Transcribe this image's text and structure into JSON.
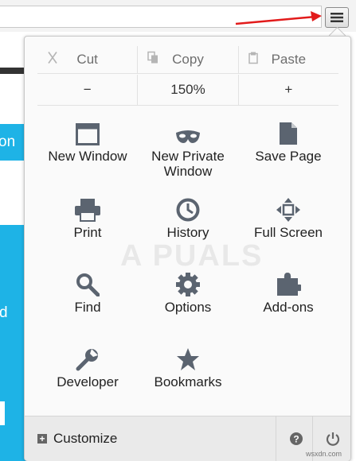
{
  "menu": {
    "edit": {
      "cut": "Cut",
      "copy": "Copy",
      "paste": "Paste"
    },
    "zoom": {
      "out": "−",
      "level": "150%",
      "in": "+"
    },
    "items": [
      {
        "label": "New Window",
        "icon": "new-window-icon"
      },
      {
        "label": "New Private Window",
        "icon": "private-mask-icon"
      },
      {
        "label": "Save Page",
        "icon": "save-page-icon"
      },
      {
        "label": "Print",
        "icon": "printer-icon"
      },
      {
        "label": "History",
        "icon": "clock-icon"
      },
      {
        "label": "Full Screen",
        "icon": "fullscreen-icon"
      },
      {
        "label": "Find",
        "icon": "magnifier-icon"
      },
      {
        "label": "Options",
        "icon": "gear-icon"
      },
      {
        "label": "Add-ons",
        "icon": "puzzle-icon"
      },
      {
        "label": "Developer",
        "icon": "wrench-icon"
      },
      {
        "label": "Bookmarks",
        "icon": "star-icon"
      }
    ],
    "footer": {
      "customize": "Customize"
    }
  },
  "background": {
    "text1": "on",
    "text2": "d"
  },
  "watermark": "A PUALS",
  "credit": "wsxdn.com",
  "colors": {
    "accent": "#1eb3e6",
    "arrow": "#e21b1b",
    "icon": "#5b6470"
  }
}
